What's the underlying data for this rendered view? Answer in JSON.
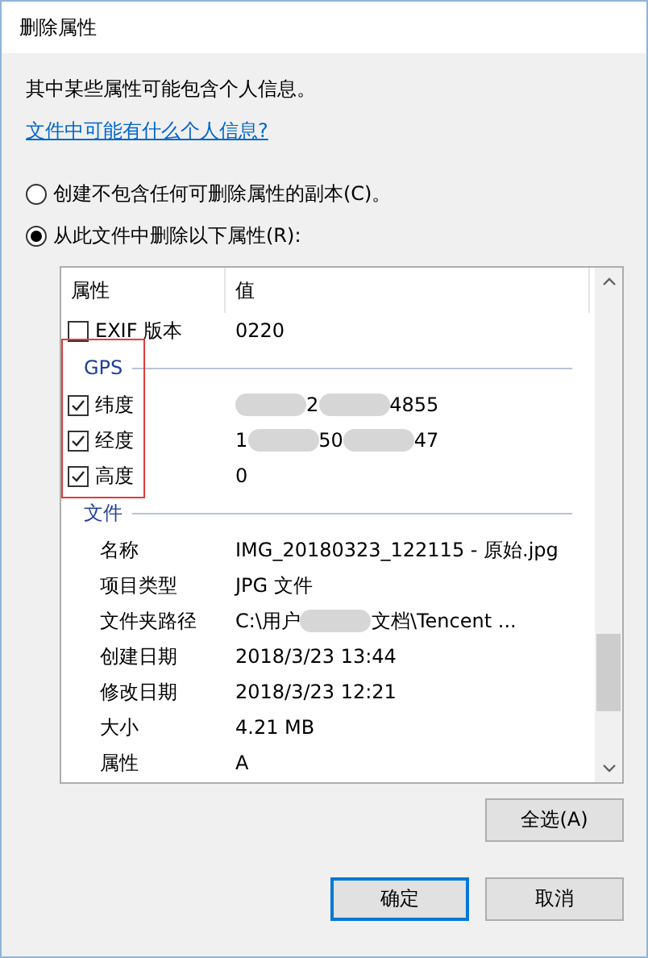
{
  "window": {
    "title": "删除属性"
  },
  "intro": "其中某些属性可能包含个人信息。",
  "help_link": "文件中可能有什么个人信息?",
  "options": [
    {
      "label": "创建不包含任何可删除属性的副本(C)。",
      "selected": false
    },
    {
      "label": "从此文件中删除以下属性(R):",
      "selected": true
    }
  ],
  "table": {
    "columns": [
      "属性",
      "值"
    ],
    "rows": [
      {
        "kind": "item",
        "checked": false,
        "name": "EXIF 版本",
        "parts": [
          {
            "kind": "text",
            "text": "0220"
          }
        ]
      },
      {
        "kind": "group",
        "name": "GPS",
        "highlighted": true
      },
      {
        "kind": "item",
        "checked": true,
        "name": "纬度",
        "highlighted": true,
        "parts": [
          {
            "kind": "blur"
          },
          {
            "kind": "text",
            "text": "2"
          },
          {
            "kind": "blur"
          },
          {
            "kind": "text",
            "text": "4855"
          }
        ]
      },
      {
        "kind": "item",
        "checked": true,
        "name": "经度",
        "highlighted": true,
        "parts": [
          {
            "kind": "text",
            "text": "1"
          },
          {
            "kind": "blur"
          },
          {
            "kind": "text",
            "text": "50"
          },
          {
            "kind": "blur"
          },
          {
            "kind": "text",
            "text": "47"
          }
        ]
      },
      {
        "kind": "item",
        "checked": true,
        "name": "高度",
        "highlighted": true,
        "parts": [
          {
            "kind": "text",
            "text": "0"
          }
        ]
      },
      {
        "kind": "group",
        "name": "文件"
      },
      {
        "kind": "info",
        "name": "名称",
        "parts": [
          {
            "kind": "text",
            "text": "IMG_20180323_122115 - 原始.jpg"
          }
        ]
      },
      {
        "kind": "info",
        "name": "项目类型",
        "parts": [
          {
            "kind": "text",
            "text": "JPG 文件"
          }
        ]
      },
      {
        "kind": "info",
        "name": "文件夹路径",
        "parts": [
          {
            "kind": "text",
            "text": "C:\\用户"
          },
          {
            "kind": "blur"
          },
          {
            "kind": "text",
            "text": "文档\\Tencent ..."
          }
        ]
      },
      {
        "kind": "info",
        "name": "创建日期",
        "parts": [
          {
            "kind": "text",
            "text": "2018/3/23 13:44"
          }
        ]
      },
      {
        "kind": "info",
        "name": "修改日期",
        "parts": [
          {
            "kind": "text",
            "text": "2018/3/23 12:21"
          }
        ]
      },
      {
        "kind": "info",
        "name": "大小",
        "parts": [
          {
            "kind": "text",
            "text": "4.21 MB"
          }
        ]
      },
      {
        "kind": "info",
        "name": "属性",
        "parts": [
          {
            "kind": "text",
            "text": "A"
          }
        ]
      }
    ]
  },
  "select_all_button": "全选(A)",
  "buttons": [
    {
      "label": "确定",
      "default": true
    },
    {
      "label": "取消",
      "default": false
    }
  ]
}
